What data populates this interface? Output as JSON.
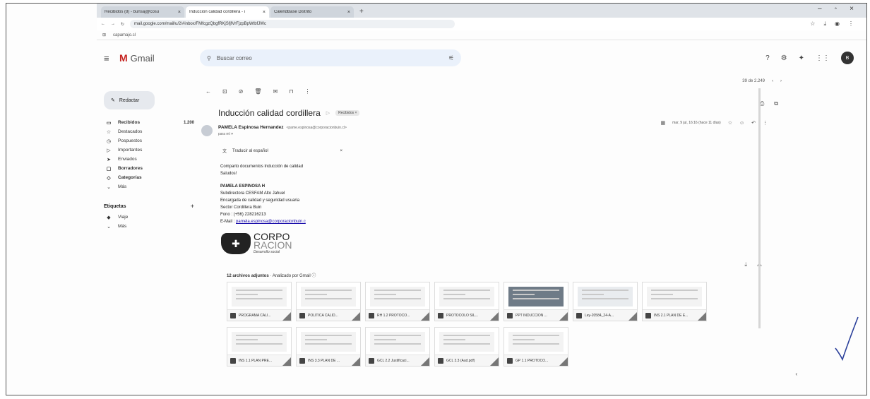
{
  "browser": {
    "tabs": [
      {
        "label": "Recibidos (8) - bunsaj@cosu"
      },
      {
        "label": "Inducción calidad cordillera - i"
      },
      {
        "label": "CalendBase Distrito"
      }
    ],
    "url": "mail.google.com/mail/u/2/#inbox/FMfcgzQbgfRKjSfjfVrFjzpBpWtbfJWc",
    "bookmark": "capamajo.cl"
  },
  "gmail": {
    "logo": "Gmail",
    "search_placeholder": "Buscar correo",
    "avatar_letter": "B",
    "pager": "39 de 2.249"
  },
  "sidebar": {
    "compose": "Redactar",
    "items": [
      {
        "icon": "inbox-icon",
        "label": "Recibidos",
        "count": "1.200",
        "bold": true
      },
      {
        "icon": "star-icon",
        "label": "Destacados"
      },
      {
        "icon": "clock-icon",
        "label": "Pospuestos"
      },
      {
        "icon": "important-icon",
        "label": "Importantes"
      },
      {
        "icon": "send-icon",
        "label": "Enviados"
      },
      {
        "icon": "draft-icon",
        "label": "Borradores",
        "bold": true
      },
      {
        "icon": "category-icon",
        "label": "Categorías",
        "bold": true
      },
      {
        "icon": "chevron-down-icon",
        "label": "Más"
      }
    ],
    "labels_title": "Etiquetas",
    "labels": [
      {
        "label": "Viaje"
      },
      {
        "label": "Más"
      }
    ]
  },
  "email": {
    "subject": "Inducción calidad cordillera",
    "label": "Recibidos ×",
    "sender_name": "PAMELA Espinosa Hernandez",
    "sender_email": "<pame.espinosa@corporacionbuin.cl>",
    "to": "para mí ▾",
    "date": "mar, 9 jul, 16:16 (hace 11 días)",
    "translate": "Traducir al español",
    "body_line1": "Comparto documentos Inducción de calidad",
    "body_line2": "Saludos!",
    "sig_name": "PAMELA ESPINOSA H",
    "sig_l1": "Subdirectora CESFAM Alto Jahuel",
    "sig_l2": "Encargada de calidad y seguridad usuaria",
    "sig_l3": "Sector Cordillera Buin",
    "sig_phone": "Fono    : (+56) 228216213",
    "sig_mail_label": "E-Mail  : ",
    "sig_mail": "pamela.espinosa@corporacionbuin.c",
    "logo_l1": "CORPO",
    "logo_l2": "RACION",
    "logo_l3": "Desarrollo social"
  },
  "attachments": {
    "header": "12 archivos adjuntos",
    "scanned": " · Analizado por Gmail ⓘ",
    "items": [
      {
        "name": "PROGRAMA CALI..."
      },
      {
        "name": "POLITICA CALID..."
      },
      {
        "name": "RH 1.2 PROTOCO..."
      },
      {
        "name": "PROTOCOLO SIL..."
      },
      {
        "name": "PPT INDUCCIÓN ..."
      },
      {
        "name": "Ley-20584_24-A..."
      },
      {
        "name": "INS 2.1 PLAN DE E..."
      },
      {
        "name": "INS 1.1 PLAN PRE..."
      },
      {
        "name": "INS 3.3 PLAN DE ..."
      },
      {
        "name": "GCL 2.2 Justificaci..."
      },
      {
        "name": "GCL 3.3 (Aud.pdf)"
      },
      {
        "name": "GP 1.1 PROTOCO..."
      }
    ]
  }
}
